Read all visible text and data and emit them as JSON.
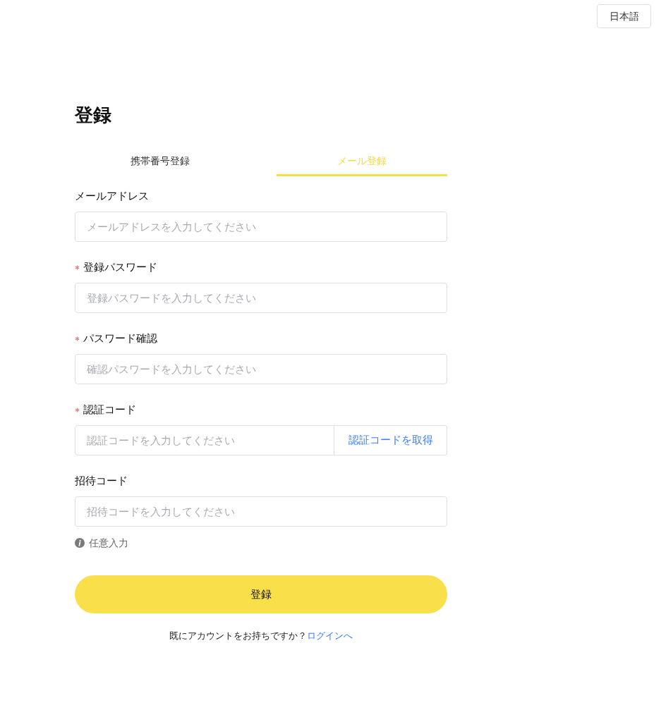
{
  "language_button": {
    "label": "日本語"
  },
  "title": "登録",
  "tabs": [
    {
      "label": "携帯番号登録",
      "selected": false
    },
    {
      "label": "メール登録",
      "selected": true
    }
  ],
  "fields": [
    {
      "kind": "text",
      "label": "メールアドレス",
      "required": false,
      "placeholder": "メールアドレスを入力してください"
    },
    {
      "kind": "text",
      "label": "登録パスワード",
      "required": true,
      "placeholder": "登録パスワードを入力してください"
    },
    {
      "kind": "text",
      "label": "パスワード確認",
      "required": true,
      "placeholder": "確認パスワードを入力してください"
    },
    {
      "kind": "code",
      "label": "認証コード",
      "required": true,
      "placeholder": "認証コードを入力してください",
      "action": "認証コードを取得"
    },
    {
      "kind": "text",
      "label": "招待コード",
      "required": false,
      "placeholder": "招待コードを入力してください",
      "hint": "任意入力"
    }
  ],
  "submit_button": {
    "label": "登録"
  },
  "footer": {
    "text": "既にアカウントをお持ちですか？",
    "link": "ログインへ"
  }
}
